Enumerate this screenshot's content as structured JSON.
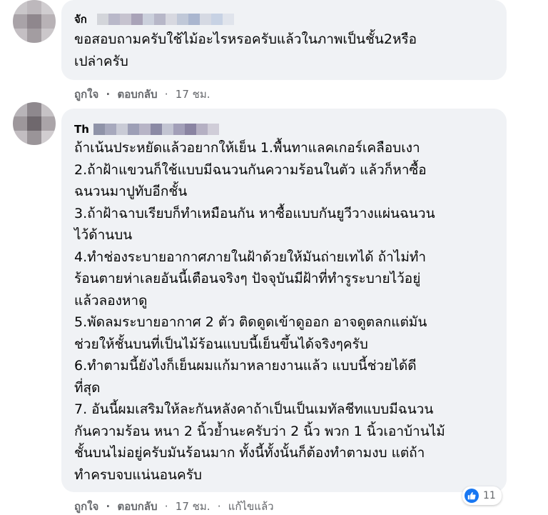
{
  "comments": [
    {
      "author_visible": "จัก",
      "lines": [
        "ขอสอบถามครับใช้ไม้อะไรหรอครับแล้วในภาพเป็นชั้น2หรือ",
        "เปล่าครับ"
      ],
      "actions": {
        "like": "ถูกใจ",
        "reply": "ตอบกลับ",
        "sep": "·",
        "time": "17 ชม."
      }
    },
    {
      "author_visible": "Th",
      "lines": [
        "ถ้าเน้นประหยัดแล้วอยากให้เย็น 1.พื้นทาแลคเกอร์เคลือบเงา",
        "2.ถ้าฝ้าแขวนก็ใช้แบบมีฉนวนกันความร้อนในตัว แล้วก็หาซื้อ",
        "ฉนวนมาปูทับอีกชั้น",
        "3.ถ้าฝ้าฉาบเรียบก็ทำเหมือนกัน หาซื้อแบบกันยูวีวางแผ่นฉนวน",
        "ไว้ด้านบน",
        "4.ทำช่องระบายอากาศภายในฝ้าด้วยให้มันถ่ายเทได้ ถ้าไม่ทำ",
        "ร้อนตายห่าเลยอันนี้เตือนจริงๆ ปัจจุบันมีฝ้าที่ทำรูระบายไว้อยู่",
        "แล้วลองหาดู",
        "5.พัดลมระบายอากาศ 2 ตัว ติดดูดเข้าดูออก อาจดูตลกแต่มัน",
        "ช่วยให้ชั้นบนที่เป็นไม้ร้อนแบบนี้เย็นขึ้นได้จริงๆครับ",
        "6.ทำตามนี้ยังไงก็เย็นผมแก้มาหลายงานแล้ว แบบนี้ช่วยได้ดี",
        "ที่สุด",
        "7. อันนี้ผมเสริมให้ละกันหลังคาถ้าเป็นเป็นเมทัลชีทแบบมีฉนวน",
        "กันความร้อน หนา 2 นิ้วย้ำนะครับว่า 2 นิ้ว พวก 1 นิ้วเอาบ้านไม้",
        "ชั้นบนไม่อยู่ครับมันร้อนมาก ทั้งนี้ทั้งนั้นก็ต้องทำตามงบ แต่ถ้า",
        "ทำครบจบแน่นอนครับ"
      ],
      "reaction_count": "11",
      "actions": {
        "like": "ถูกใจ",
        "reply": "ตอบกลับ",
        "sep": "·",
        "time": "17 ชม.",
        "edited": "แก้ไขแล้ว"
      }
    }
  ],
  "colors": {
    "bubble": "#f0f2f5",
    "meta": "#65676b",
    "like_blue": "#1877f2"
  },
  "icons": {
    "reaction": "like-icon"
  }
}
